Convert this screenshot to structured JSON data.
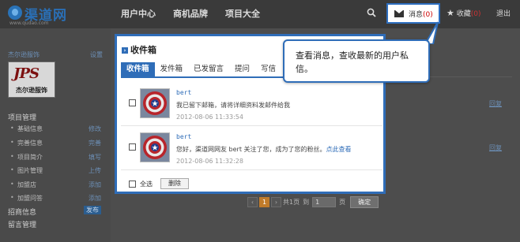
{
  "header": {
    "logo_name": "渠道网",
    "logo_url": "www.qudao.com",
    "nav": [
      "用户中心",
      "商机品牌",
      "项目大全"
    ],
    "messages_label": "消息",
    "messages_count": "(0)",
    "favorites_label": "收藏",
    "favorites_count": "(0)",
    "logout": "退出"
  },
  "sidebar": {
    "company": "杰尔逊服饰",
    "settings": "设置",
    "logo_text": "JPS",
    "logo_caption": "杰尔逊服饰",
    "project_mgmt": "项目管理",
    "items": [
      {
        "label": "基础信息",
        "action": "修改"
      },
      {
        "label": "完善信息",
        "action": "完善"
      },
      {
        "label": "项目简介",
        "action": "填写"
      },
      {
        "label": "图片管理",
        "action": "上传"
      },
      {
        "label": "加盟店",
        "action": "添加"
      },
      {
        "label": "加盟问答",
        "action": "添加"
      }
    ],
    "recruit": "招商信息",
    "publish": "发布",
    "messages_mgmt": "留言管理"
  },
  "main": {
    "reply": "回复",
    "pager": {
      "current": "1",
      "total_text": "共1页",
      "goto_label": "到",
      "goto_value": "1",
      "page_label": "页",
      "confirm": "确定"
    }
  },
  "inbox": {
    "title": "收件箱",
    "tabs": [
      "收件箱",
      "发件箱",
      "已发留言",
      "提问",
      "写信"
    ],
    "messages": [
      {
        "sender": "bert",
        "text": "我已留下邮箱，请将详细资料发邮件给我",
        "link": "",
        "time": "2012-08-06 11:33:54"
      },
      {
        "sender": "bert",
        "text": "您好，渠道网网友 bert 关注了您，成为了您的粉丝。",
        "link": "点此查看",
        "time": "2012-08-06 11:32:28"
      }
    ],
    "select_all": "全选",
    "delete": "删除"
  },
  "callout": {
    "text": "查看消息，查收最新的用户私信。"
  },
  "colors": {
    "accent": "#2f6db8",
    "badge": "#cc0000"
  }
}
